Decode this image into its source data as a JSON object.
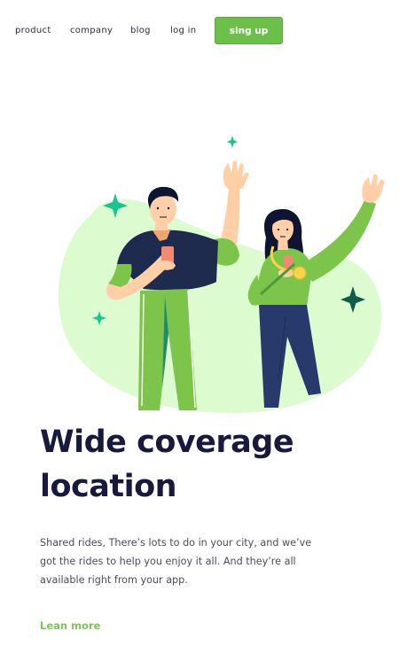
{
  "nav": {
    "items": [
      {
        "label": "product"
      },
      {
        "label": "company"
      },
      {
        "label": "blog"
      },
      {
        "label": "log in"
      }
    ],
    "signup_label": "sing up"
  },
  "hero": {
    "title": "Wide coverage location",
    "description": "Shared rides, There’s lots to do in your city, and we’ve got the rides to help you enjoy it all. And they’re all available right from your app.",
    "link_label": "Lean more"
  },
  "colors": {
    "accent": "#6cc04a",
    "heading": "#171a3d",
    "blob": "#dcfcd0",
    "sparkle": "#18c58f",
    "sparkle_dark": "#0e5c4a",
    "navy": "#283a6b"
  }
}
